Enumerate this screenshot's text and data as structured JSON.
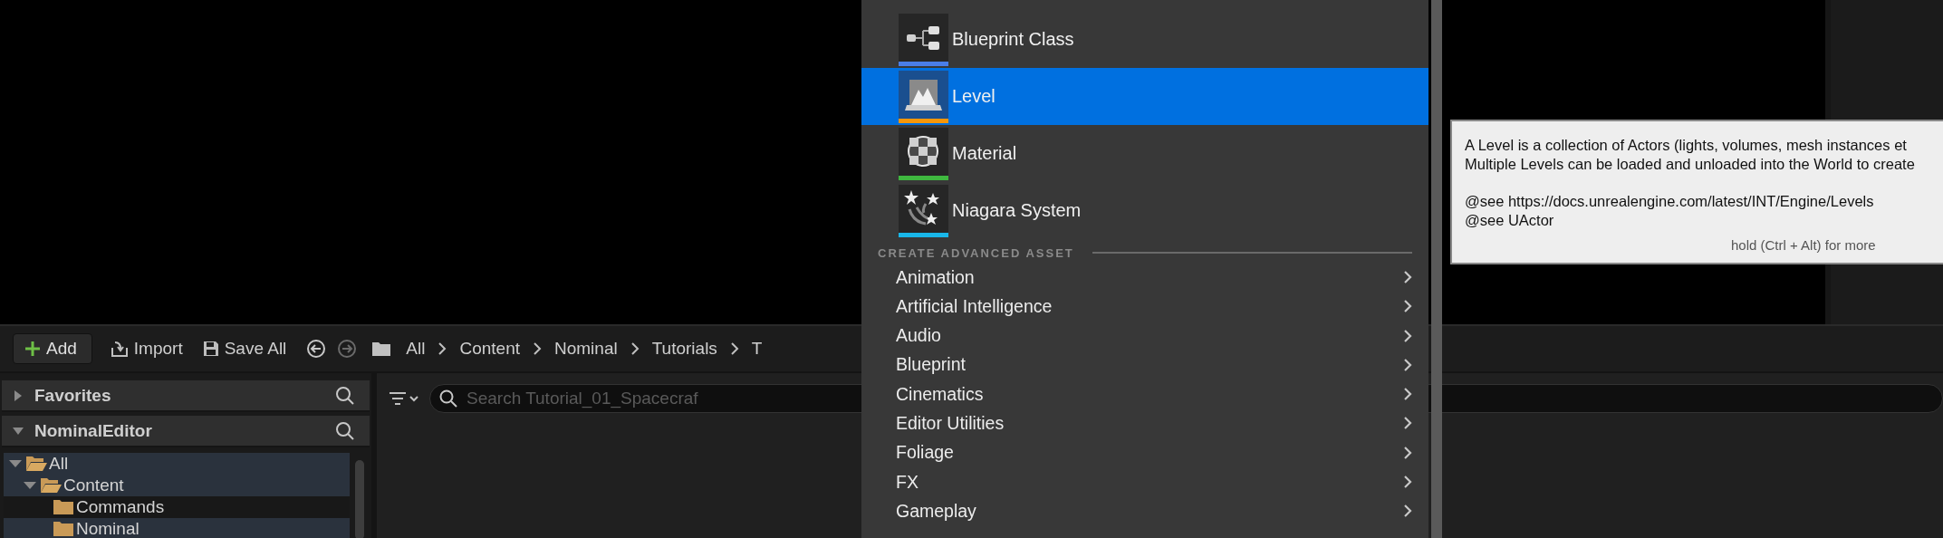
{
  "toolbar": {
    "add": "Add",
    "import": "Import",
    "save_all": "Save All",
    "nav": [
      {
        "kind": "back",
        "disabled": false
      },
      {
        "kind": "forward",
        "disabled": true
      }
    ],
    "breadcrumbs": [
      "All",
      "Content",
      "Nominal",
      "Tutorials",
      "T"
    ]
  },
  "sources": {
    "sections": [
      {
        "label": "Favorites",
        "expanded": false
      },
      {
        "label": "NominalEditor",
        "expanded": true
      }
    ],
    "tree": [
      {
        "label": "All",
        "expanded": true,
        "selected": true,
        "children": [
          {
            "label": "Content",
            "expanded": true,
            "selected": true,
            "children": [
              {
                "label": "Commands",
                "selected": false
              },
              {
                "label": "Nominal",
                "selected": true
              }
            ]
          }
        ]
      }
    ]
  },
  "content": {
    "search": {
      "placeholder": "Search Tutorial_01_Spacecraf"
    }
  },
  "add_menu": {
    "featured": [
      {
        "kind": "blueprint",
        "label": "Blueprint Class",
        "color": "#4a7ee8",
        "selected": false
      },
      {
        "kind": "level",
        "label": "Level",
        "color": "#f5960a",
        "selected": true
      },
      {
        "kind": "material",
        "label": "Material",
        "color": "#3fb83f",
        "selected": false
      },
      {
        "kind": "niagara",
        "label": "Niagara System",
        "color": "#19b7ea",
        "selected": false
      }
    ],
    "section_header": "CREATE ADVANCED ASSET",
    "categories": [
      "Animation",
      "Artificial Intelligence",
      "Audio",
      "Blueprint",
      "Cinematics",
      "Editor Utilities",
      "Foliage",
      "FX",
      "Gameplay"
    ]
  },
  "tooltip": {
    "paragraphs": [
      [
        "A Level is a collection of Actors (lights, volumes, mesh instances et",
        "Multiple Levels can be loaded and unloaded into the World to create"
      ],
      [
        "@see https://docs.unrealengine.com/latest/INT/Engine/Levels",
        "@see UActor"
      ]
    ],
    "hint": "hold (Ctrl + Alt) for more"
  }
}
